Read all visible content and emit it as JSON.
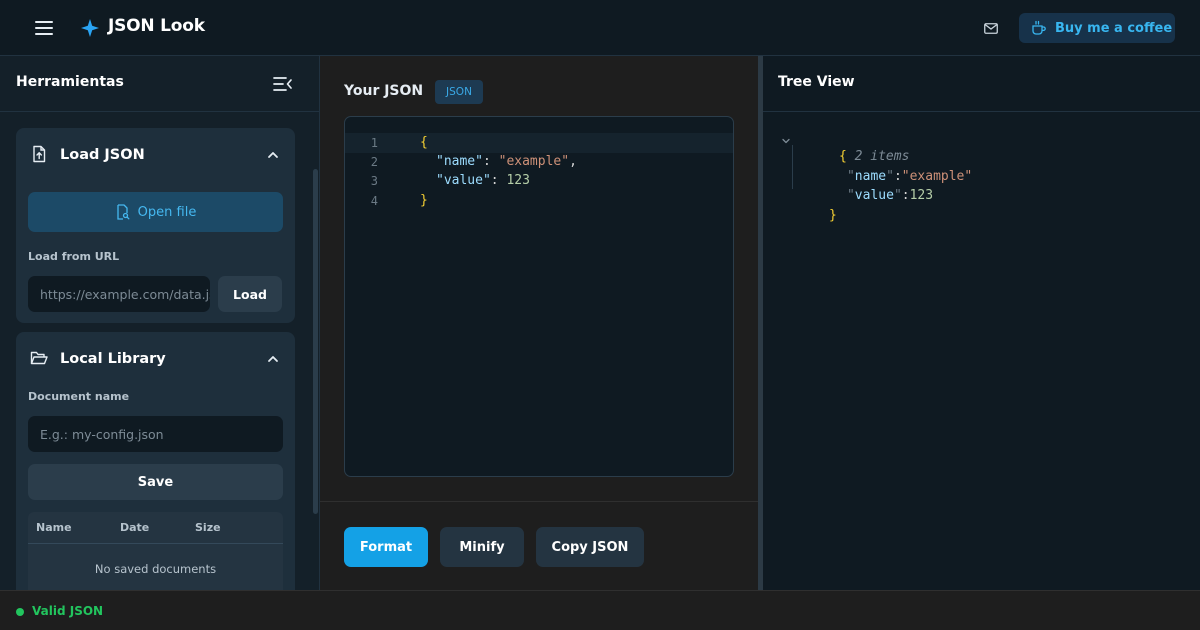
{
  "app": {
    "title": "JSON Look",
    "coffee_label": "Buy me a coffee",
    "icons": {
      "menu": "hamburger-menu-icon",
      "logo": "sparkle-icon",
      "mail": "mail-icon",
      "coffee": "coffee-cup-icon"
    }
  },
  "colors": {
    "accent": "#14a1e6",
    "logo": "#2aa4f4",
    "valid": "#22c55e",
    "brace": "#f5d033",
    "key": "#9cdcfe",
    "string": "#ce9178",
    "number": "#b5cea8"
  },
  "sidebar": {
    "title": "Herramientas",
    "load_section": {
      "title": "Load JSON",
      "open_file_label": "Open file",
      "url_label": "Load from URL",
      "url_placeholder": "https://example.com/data.json",
      "load_button": "Load"
    },
    "library_section": {
      "title": "Local Library",
      "doc_name_label": "Document name",
      "doc_name_placeholder": "E.g.: my-config.json",
      "save_button": "Save",
      "table": {
        "columns": [
          "Name",
          "Date",
          "Size"
        ],
        "empty_text": "No saved documents"
      }
    }
  },
  "editor": {
    "title": "Your JSON",
    "badge": "JSON",
    "lines": [
      {
        "number": "1",
        "open": "{"
      },
      {
        "number": "2",
        "key": "\"name\"",
        "value": "\"example\"",
        "suffix": ","
      },
      {
        "number": "3",
        "key": "\"value\"",
        "value": "123",
        "suffix": ""
      },
      {
        "number": "4",
        "close": "}"
      }
    ],
    "buttons": {
      "format": "Format",
      "minify": "Minify",
      "copy": "Copy JSON"
    }
  },
  "tree": {
    "title": "Tree View",
    "root_open": "{",
    "root_summary": "2 items",
    "root_close": "}",
    "entries": [
      {
        "key": "name",
        "value": "\"example\""
      },
      {
        "key": "value",
        "value": "123"
      }
    ]
  },
  "status": {
    "text": "Valid JSON"
  }
}
